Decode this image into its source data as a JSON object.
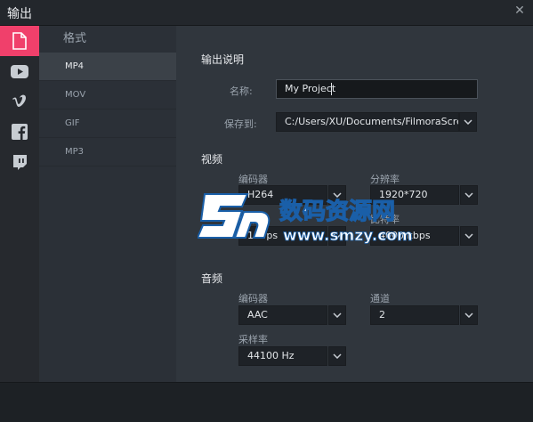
{
  "window": {
    "title": "输出"
  },
  "sidebar_icons": [
    {
      "name": "file-icon",
      "active": true
    },
    {
      "name": "youtube-icon",
      "active": false
    },
    {
      "name": "vimeo-icon",
      "active": false
    },
    {
      "name": "facebook-icon",
      "active": false
    },
    {
      "name": "twitch-icon",
      "active": false
    }
  ],
  "formats": {
    "header": "格式",
    "items": [
      "MP4",
      "MOV",
      "GIF",
      "MP3"
    ],
    "selected": "MP4"
  },
  "output": {
    "section_title": "输出说明",
    "name_label": "名称:",
    "name_value": "My Project",
    "save_label": "保存到:",
    "save_value": "C:/Users/XU/Documents/FilmoraScre"
  },
  "video": {
    "section_title": "视频",
    "encoder_label": "编码器",
    "encoder_value": "H264",
    "resolution_label": "分辨率",
    "resolution_value": "1920*720",
    "framerate_label": "帧率",
    "framerate_value": "15 fps",
    "bitrate_label": "比特率",
    "bitrate_value": "4000 kbps"
  },
  "audio": {
    "section_title": "音频",
    "encoder_label": "编码器",
    "encoder_value": "AAC",
    "channel_label": "通道",
    "channel_value": "2",
    "samplerate_label": "采样率",
    "samplerate_value": "44100 Hz"
  },
  "watermark": {
    "line1": "数码资源网",
    "line2": "www.smzy.com"
  },
  "colors": {
    "accent": "#f0406b",
    "panel": "#30363d"
  }
}
